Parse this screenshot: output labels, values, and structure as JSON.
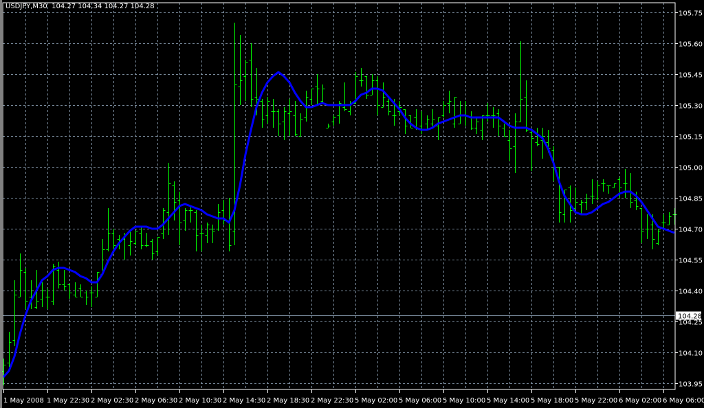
{
  "header": {
    "symbol": "USDJPY,M30",
    "ohlc": "104.27 104.34 104.27 104.28"
  },
  "colors": {
    "background": "#000000",
    "grid": "#778899",
    "bars": "#00ff00",
    "moving_average": "#0000ff",
    "axis": "#ffffff",
    "bid_line": "#778899"
  },
  "chart_data": {
    "type": "ohlc",
    "symbol": "USDJPY",
    "timeframe": "M30",
    "ylim": [
      103.95,
      105.75
    ],
    "grid": true,
    "y_ticks": [
      "105.75",
      "105.60",
      "105.45",
      "105.30",
      "105.15",
      "105.00",
      "104.85",
      "104.70",
      "104.55",
      "104.40",
      "104.25",
      "104.10",
      "103.95"
    ],
    "x_ticks": [
      {
        "bar": 0,
        "label": "1 May 2008"
      },
      {
        "bar": 8,
        "label": "1 May 22:30"
      },
      {
        "bar": 16,
        "label": "2 May 02:30"
      },
      {
        "bar": 24,
        "label": "2 May 06:30"
      },
      {
        "bar": 32,
        "label": "2 May 10:30"
      },
      {
        "bar": 40,
        "label": "2 May 14:30"
      },
      {
        "bar": 48,
        "label": "2 May 18:30"
      },
      {
        "bar": 56,
        "label": "2 May 22:30"
      },
      {
        "bar": 64,
        "label": "5 May 02:00"
      },
      {
        "bar": 72,
        "label": "5 May 06:00"
      },
      {
        "bar": 80,
        "label": "5 May 10:00"
      },
      {
        "bar": 88,
        "label": "5 May 14:00"
      },
      {
        "bar": 96,
        "label": "5 May 18:00"
      },
      {
        "bar": 104,
        "label": "5 May 22:00"
      },
      {
        "bar": 112,
        "label": "6 May 02:00"
      },
      {
        "bar": 120,
        "label": "6 May 06:00"
      }
    ],
    "bid_price": "104.28",
    "ohlc": [
      [
        104.01,
        104.07,
        103.94,
        104.04
      ],
      [
        104.05,
        104.2,
        104.03,
        104.15
      ],
      [
        104.16,
        104.45,
        104.13,
        104.38
      ],
      [
        104.37,
        104.58,
        104.37,
        104.5
      ],
      [
        104.49,
        104.51,
        104.31,
        104.35
      ],
      [
        104.37,
        104.45,
        104.31,
        104.37
      ],
      [
        104.32,
        104.5,
        104.31,
        104.35
      ],
      [
        104.36,
        104.44,
        104.32,
        104.4
      ],
      [
        104.37,
        104.41,
        104.31,
        104.37
      ],
      [
        104.35,
        104.53,
        104.33,
        104.52
      ],
      [
        104.5,
        104.54,
        104.41,
        104.43
      ],
      [
        104.43,
        104.5,
        104.4,
        104.42
      ],
      [
        104.43,
        104.43,
        104.36,
        104.39
      ],
      [
        104.38,
        104.44,
        104.37,
        104.37
      ],
      [
        104.41,
        104.43,
        104.37,
        104.37
      ],
      [
        104.39,
        104.4,
        104.33,
        104.37
      ],
      [
        104.39,
        104.42,
        104.32,
        104.39
      ],
      [
        104.37,
        104.49,
        104.37,
        104.49
      ],
      [
        104.48,
        104.65,
        104.48,
        104.6
      ],
      [
        104.6,
        104.8,
        104.59,
        104.68
      ],
      [
        104.68,
        104.7,
        104.58,
        104.62
      ],
      [
        104.65,
        104.67,
        104.6,
        104.64
      ],
      [
        104.65,
        104.68,
        104.55,
        104.67
      ],
      [
        104.62,
        104.69,
        104.57,
        104.64
      ],
      [
        104.63,
        104.69,
        104.62,
        104.69
      ],
      [
        104.68,
        104.71,
        104.6,
        104.62
      ],
      [
        104.62,
        104.68,
        104.61,
        104.62
      ],
      [
        104.64,
        104.65,
        104.55,
        104.58
      ],
      [
        104.59,
        104.66,
        104.57,
        104.66
      ],
      [
        104.68,
        104.8,
        104.65,
        104.79
      ],
      [
        104.78,
        105.02,
        104.67,
        104.92
      ],
      [
        104.91,
        104.93,
        104.74,
        104.83
      ],
      [
        104.84,
        104.88,
        104.62,
        104.73
      ],
      [
        104.74,
        104.8,
        104.69,
        104.79
      ],
      [
        104.79,
        104.81,
        104.73,
        104.79
      ],
      [
        104.78,
        104.79,
        104.59,
        104.67
      ],
      [
        104.68,
        104.72,
        104.59,
        104.68
      ],
      [
        104.67,
        104.73,
        104.63,
        104.72
      ],
      [
        104.7,
        104.72,
        104.63,
        104.69
      ],
      [
        104.7,
        104.82,
        104.69,
        104.78
      ],
      [
        104.79,
        104.84,
        104.72,
        104.74
      ],
      [
        104.74,
        104.85,
        104.59,
        104.62
      ],
      [
        104.69,
        105.7,
        104.62,
        105.4
      ],
      [
        105.39,
        105.64,
        105.3,
        105.42
      ],
      [
        105.44,
        105.52,
        105.32,
        105.51
      ],
      [
        105.52,
        105.6,
        105.29,
        105.33
      ],
      [
        105.34,
        105.48,
        105.25,
        105.33
      ],
      [
        105.32,
        105.33,
        105.19,
        105.23
      ],
      [
        105.25,
        105.34,
        105.21,
        105.32
      ],
      [
        105.27,
        105.33,
        105.19,
        105.27
      ],
      [
        105.27,
        105.28,
        105.15,
        105.21
      ],
      [
        105.22,
        105.29,
        105.13,
        105.27
      ],
      [
        105.26,
        105.33,
        105.15,
        105.27
      ],
      [
        105.25,
        105.32,
        105.15,
        105.16
      ],
      [
        105.15,
        105.26,
        105.15,
        105.23
      ],
      [
        105.24,
        105.37,
        105.22,
        105.34
      ],
      [
        105.33,
        105.38,
        105.3,
        105.38
      ],
      [
        105.39,
        105.45,
        105.3,
        105.38
      ],
      [
        105.32,
        105.4,
        105.31,
        105.38
      ],
      [
        105.19,
        105.21,
        105.19,
        105.2
      ],
      [
        105.22,
        105.25,
        105.2,
        105.24
      ],
      [
        105.25,
        105.32,
        105.21,
        105.31
      ],
      [
        105.29,
        105.41,
        105.27,
        105.28
      ],
      [
        105.27,
        105.32,
        105.25,
        105.31
      ],
      [
        105.31,
        105.46,
        105.31,
        105.44
      ],
      [
        105.42,
        105.48,
        105.39,
        105.42
      ],
      [
        105.44,
        105.44,
        105.33,
        105.35
      ],
      [
        105.35,
        105.45,
        105.35,
        105.42
      ],
      [
        105.42,
        105.44,
        105.25,
        105.3
      ],
      [
        105.29,
        105.41,
        105.29,
        105.34
      ],
      [
        105.32,
        105.34,
        105.25,
        105.27
      ],
      [
        105.25,
        105.33,
        105.2,
        105.25
      ],
      [
        105.27,
        105.32,
        105.25,
        105.29
      ],
      [
        105.28,
        105.28,
        105.16,
        105.2
      ],
      [
        105.25,
        105.25,
        105.19,
        105.19
      ],
      [
        105.24,
        105.28,
        105.18,
        105.19
      ],
      [
        105.2,
        105.27,
        105.16,
        105.18
      ],
      [
        105.21,
        105.25,
        105.18,
        105.23
      ],
      [
        105.21,
        105.28,
        105.19,
        105.23
      ],
      [
        105.2,
        105.24,
        105.13,
        105.24
      ],
      [
        105.25,
        105.32,
        105.24,
        105.3
      ],
      [
        105.31,
        105.37,
        105.26,
        105.32
      ],
      [
        105.21,
        105.34,
        105.19,
        105.34
      ],
      [
        105.21,
        105.32,
        105.21,
        105.25
      ],
      [
        105.25,
        105.32,
        105.2,
        105.25
      ],
      [
        105.24,
        105.27,
        105.18,
        105.19
      ],
      [
        105.19,
        105.24,
        105.16,
        105.22
      ],
      [
        105.18,
        105.25,
        105.13,
        105.25
      ],
      [
        105.25,
        105.31,
        105.22,
        105.25
      ],
      [
        105.25,
        105.29,
        105.19,
        105.25
      ],
      [
        105.26,
        105.28,
        105.15,
        105.2
      ],
      [
        105.19,
        105.21,
        105.15,
        105.15
      ],
      [
        105.13,
        105.18,
        105.03,
        105.09
      ],
      [
        105.1,
        105.26,
        104.97,
        105.22
      ],
      [
        105.22,
        105.61,
        105.22,
        105.33
      ],
      [
        105.34,
        105.42,
        105.17,
        105.18
      ],
      [
        105.17,
        105.18,
        104.98,
        105.14
      ],
      [
        105.12,
        105.19,
        105.1,
        105.11
      ],
      [
        105.13,
        105.19,
        105.04,
        105.15
      ],
      [
        105.12,
        105.18,
        105.07,
        105.09
      ],
      [
        105.08,
        105.1,
        104.93,
        105.0
      ],
      [
        105.0,
        105.0,
        104.73,
        104.78
      ],
      [
        104.77,
        104.89,
        104.73,
        104.89
      ],
      [
        104.9,
        104.91,
        104.73,
        104.79
      ],
      [
        104.8,
        104.9,
        104.8,
        104.83
      ],
      [
        104.82,
        104.84,
        104.77,
        104.83
      ],
      [
        104.83,
        104.87,
        104.79,
        104.85
      ],
      [
        104.86,
        104.94,
        104.82,
        104.86
      ],
      [
        104.85,
        104.93,
        104.84,
        104.91
      ],
      [
        104.92,
        104.94,
        104.88,
        104.92
      ],
      [
        104.91,
        104.91,
        104.87,
        104.91
      ],
      [
        104.9,
        104.92,
        104.9,
        104.92
      ],
      [
        104.94,
        104.95,
        104.85,
        104.9
      ],
      [
        104.92,
        104.99,
        104.85,
        104.92
      ],
      [
        104.88,
        104.97,
        104.8,
        104.83
      ],
      [
        104.84,
        104.88,
        104.79,
        104.81
      ],
      [
        104.8,
        104.8,
        104.63,
        104.69
      ],
      [
        104.7,
        104.77,
        104.65,
        104.7
      ],
      [
        104.72,
        104.77,
        104.6,
        104.65
      ],
      [
        104.63,
        104.7,
        104.62,
        104.69
      ],
      [
        104.73,
        104.77,
        104.7,
        104.73
      ],
      [
        104.72,
        104.78,
        104.72,
        104.76
      ],
      [
        104.77,
        104.8,
        104.72,
        104.77
      ]
    ],
    "moving_average": [
      103.98,
      104.01,
      104.08,
      104.19,
      104.28,
      104.35,
      104.4,
      104.45,
      104.47,
      104.5,
      104.51,
      104.51,
      104.5,
      104.49,
      104.47,
      104.46,
      104.44,
      104.44,
      104.48,
      104.54,
      104.59,
      104.63,
      104.66,
      104.69,
      104.71,
      104.71,
      104.71,
      104.7,
      104.7,
      104.72,
      104.75,
      104.78,
      104.81,
      104.82,
      104.81,
      104.8,
      104.79,
      104.77,
      104.76,
      104.75,
      104.75,
      104.73,
      104.79,
      104.91,
      105.06,
      105.18,
      105.29,
      105.36,
      105.41,
      105.44,
      105.46,
      105.44,
      105.41,
      105.36,
      105.32,
      105.29,
      105.29,
      105.3,
      105.31,
      105.3,
      105.3,
      105.3,
      105.3,
      105.3,
      105.32,
      105.35,
      105.36,
      105.38,
      105.38,
      105.37,
      105.34,
      105.31,
      105.28,
      105.24,
      105.21,
      105.19,
      105.18,
      105.18,
      105.19,
      105.21,
      105.22,
      105.23,
      105.24,
      105.25,
      105.25,
      105.24,
      105.24,
      105.24,
      105.24,
      105.24,
      105.24,
      105.22,
      105.2,
      105.19,
      105.19,
      105.19,
      105.18,
      105.16,
      105.14,
      105.09,
      105.02,
      104.93,
      104.86,
      104.82,
      104.78,
      104.77,
      104.77,
      104.78,
      104.8,
      104.82,
      104.83,
      104.85,
      104.87,
      104.88,
      104.88,
      104.86,
      104.83,
      104.79,
      104.75,
      104.71,
      104.7,
      104.69,
      104.68
    ]
  }
}
